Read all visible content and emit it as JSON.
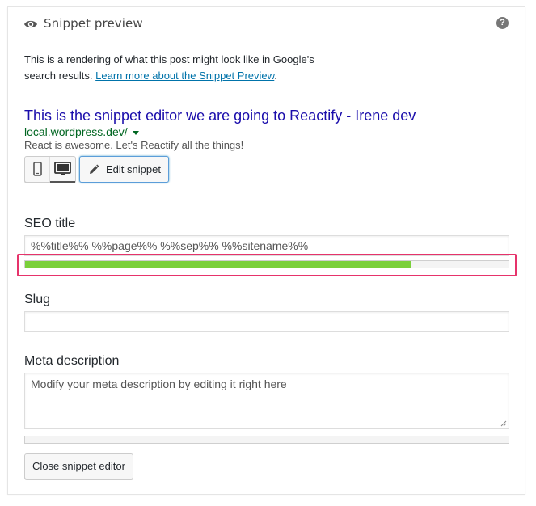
{
  "panel": {
    "title": "Snippet preview",
    "help_icon": "question-mark-icon",
    "header_icon": "eye-icon"
  },
  "intro": {
    "text": "This is a rendering of what this post might look like in Google's search results. ",
    "link": "Learn more about the Snippet Preview",
    "after": "."
  },
  "snippet": {
    "title": "This is the snippet editor we are going to Reactify - Irene dev",
    "url": "local.wordpress.dev/",
    "description": "React is awesome. Let's Reactify all the things!",
    "colors": {
      "title": "#1a0dab",
      "url": "#006621",
      "description": "#545454"
    }
  },
  "mode_switcher": {
    "mobile_icon": "smartphone-icon",
    "desktop_icon": "desktop-monitor-icon",
    "active": "desktop"
  },
  "edit_button": {
    "label": "Edit snippet",
    "icon": "pencil-icon"
  },
  "seo_title": {
    "label": "SEO title",
    "value": "%%title%% %%page%% %%sep%% %%sitename%%",
    "progress": 0.8,
    "progress_color": "#7ad03a",
    "highlight_color": "#e6336b"
  },
  "slug": {
    "label": "Slug",
    "value": ""
  },
  "meta_description": {
    "label": "Meta description",
    "value": "Modify your meta description by editing it right here",
    "progress": 0
  },
  "close_button": {
    "label": "Close snippet editor"
  }
}
